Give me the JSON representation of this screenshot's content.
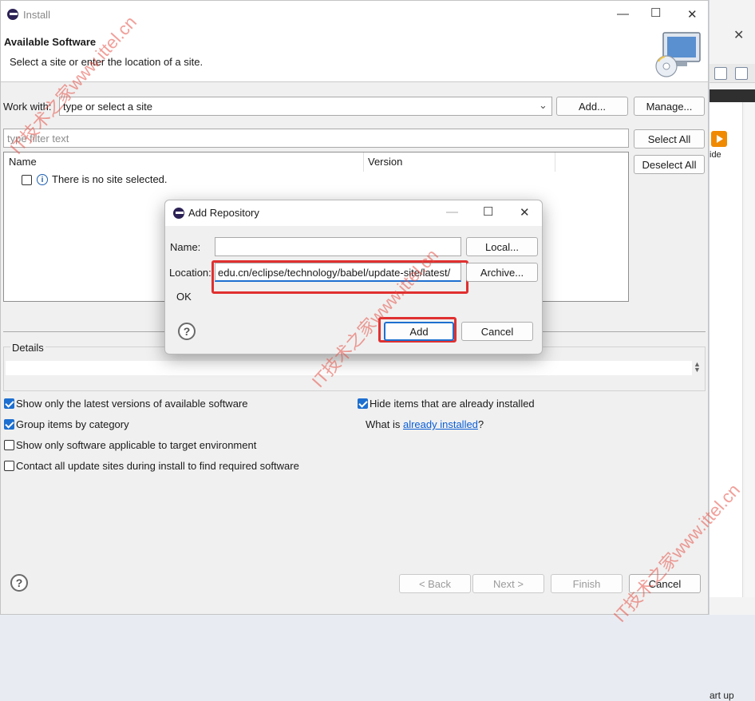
{
  "window": {
    "title": "Install"
  },
  "header": {
    "title": "Available Software",
    "subtitle": "Select a site or enter the location of a site."
  },
  "work_with": {
    "label": "Work with:",
    "value": "type or select a site",
    "add_label": "Add...",
    "manage_label": "Manage..."
  },
  "filter": {
    "placeholder": "type filter text"
  },
  "table": {
    "columns": [
      "Name",
      "Version"
    ],
    "rows": [
      {
        "name": "There is no site selected."
      }
    ]
  },
  "side_buttons": {
    "select_all": "Select All",
    "deselect_all": "Deselect All"
  },
  "details": {
    "label": "Details"
  },
  "options": [
    {
      "label": "Show only the latest versions of available software",
      "checked": true
    },
    {
      "label": "Group items by category",
      "checked": true
    },
    {
      "label": "Show only software applicable to target environment",
      "checked": false
    },
    {
      "label": "Contact all update sites during install to find required software",
      "checked": false
    },
    {
      "label": "Hide items that are already installed",
      "checked": true
    }
  ],
  "what_is": {
    "prefix": "What is ",
    "link": "already installed",
    "suffix": "?"
  },
  "footer": {
    "back": "< Back",
    "next": "Next >",
    "finish": "Finish",
    "cancel": "Cancel"
  },
  "modal": {
    "title": "Add Repository",
    "name_label": "Name:",
    "name_value": "",
    "local_button": "Local...",
    "location_label": "Location:",
    "location_value": "edu.cn/eclipse/technology/babel/update-site/latest/",
    "archive_button": "Archive...",
    "status": "OK",
    "add_button": "Add",
    "cancel_button": "Cancel"
  },
  "background_window": {
    "ide_label": "ide",
    "start_label": "art up"
  },
  "watermarks": [
    "IT技术之家www.ittel.cn",
    "IT技术之家www.ittel.cn",
    "IT技术之家www.ittel.cn"
  ],
  "colors": {
    "accent": "#1d6fd0",
    "highlight": "#e03030",
    "link": "#0b5ed7"
  }
}
